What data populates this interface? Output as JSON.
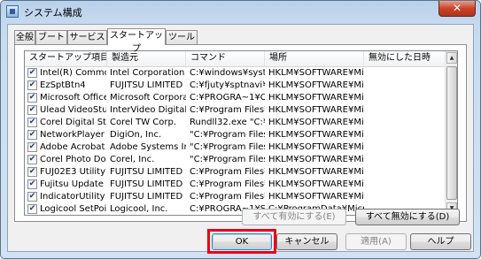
{
  "window": {
    "title": "システム構成",
    "close_glyph": "✕"
  },
  "tabs": [
    {
      "label": "全般"
    },
    {
      "label": "ブート"
    },
    {
      "label": "サービス"
    },
    {
      "label": "スタートアップ"
    },
    {
      "label": "ツール"
    }
  ],
  "active_tab": "スタートアップ",
  "table": {
    "columns": [
      "スタートアップ項目",
      "製造元",
      "コマンド",
      "場所",
      "無効にした日時"
    ],
    "rows": [
      {
        "checked": true,
        "item": "Intel(R) Commo...",
        "maker": "Intel Corporation",
        "command": "C:¥windows¥syste...",
        "location": "HKLM¥SOFTWARE¥Micr...",
        "disabled": ""
      },
      {
        "checked": true,
        "item": "EzSptBtn4",
        "maker": "FUJITSU LIMITED",
        "command": "C:¥fjuty¥sptnavi¥Ez...",
        "location": "HKLM¥SOFTWARE¥Micr...",
        "disabled": ""
      },
      {
        "checked": true,
        "item": "Microsoft Office...",
        "maker": "Microsoft Corporat...",
        "command": "C:¥PROGRA~1¥CO...",
        "location": "HKLM¥SOFTWARE¥Micr...",
        "disabled": ""
      },
      {
        "checked": true,
        "item": "Ulead VideoStu...",
        "maker": "InterVideo Digital ...",
        "command": "C:¥Program Files¥...",
        "location": "HKLM¥SOFTWARE¥Micr...",
        "disabled": ""
      },
      {
        "checked": true,
        "item": "Corel Digital St...",
        "maker": "Corel TW Corp.",
        "command": "Rundll32.exe \"C:¥P...",
        "location": "HKLM¥SOFTWARE¥Micr...",
        "disabled": ""
      },
      {
        "checked": true,
        "item": "NetworkPlayer ...",
        "maker": "DigiOn, Inc.",
        "command": "\"C:¥Program Files...",
        "location": "HKLM¥SOFTWARE¥Micr...",
        "disabled": ""
      },
      {
        "checked": true,
        "item": "Adobe Acrobat",
        "maker": "Adobe Systems In...",
        "command": "\"C:¥Program Files...",
        "location": "HKLM¥SOFTWARE¥Micr...",
        "disabled": ""
      },
      {
        "checked": true,
        "item": "Corel Photo Do...",
        "maker": "Corel, Inc.",
        "command": "\"C:¥Program Files...",
        "location": "HKLM¥SOFTWARE¥Micr...",
        "disabled": ""
      },
      {
        "checked": true,
        "item": "FUJ02E3 Utility",
        "maker": "FUJITSU LIMITED",
        "command": "C:¥Program Files¥...",
        "location": "HKLM¥SOFTWARE¥Micr...",
        "disabled": ""
      },
      {
        "checked": true,
        "item": "Fujitsu Update ...",
        "maker": "FUJITSU LIMITED",
        "command": "C:¥Program Files¥...",
        "location": "HKLM¥SOFTWARE¥Micr...",
        "disabled": ""
      },
      {
        "checked": true,
        "item": "IndicatorUtility",
        "maker": "FUJITSU LIMITED",
        "command": "C:¥Program Files¥...",
        "location": "HKLM¥SOFTWARE¥Micr...",
        "disabled": ""
      },
      {
        "checked": true,
        "item": "Logicool SetPoint",
        "maker": "Logicool, Inc.",
        "command": "C:¥PROGRA~1¥Se...",
        "location": "C:¥ProgramData¥Micros...",
        "disabled": ""
      }
    ]
  },
  "panel_buttons": {
    "enable_all": "すべて有効にする(E)",
    "disable_all": "すべて無効にする(D)"
  },
  "footer_buttons": {
    "ok": "OK",
    "cancel": "キャンセル",
    "apply": "適用(A)",
    "help": "ヘルプ"
  },
  "highlight_color": "#e8001b"
}
